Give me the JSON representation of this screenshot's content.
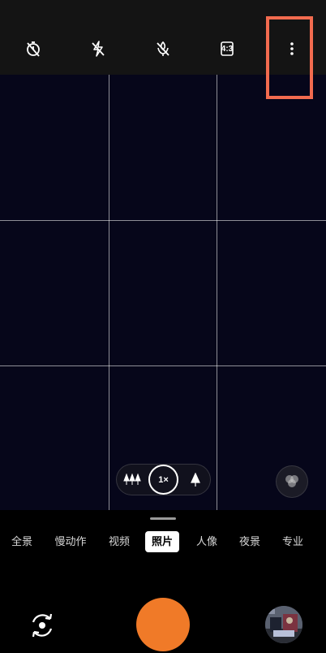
{
  "top_toolbar": {
    "buttons": [
      {
        "name": "timer-off-icon"
      },
      {
        "name": "flash-off-icon"
      },
      {
        "name": "macro-off-icon"
      },
      {
        "name": "aspect-ratio-icon",
        "label": "4:3"
      },
      {
        "name": "more-options-icon"
      }
    ]
  },
  "zoom": {
    "wide_icon": "wide-angle-trees-icon",
    "current": "1×",
    "tele_icon": "telephoto-tree-icon"
  },
  "filter_icon": "filter-circles-icon",
  "modes": [
    "全景",
    "慢动作",
    "视频",
    "照片",
    "人像",
    "夜景",
    "专业"
  ],
  "active_mode": "照片",
  "controls": {
    "switch_camera_icon": "switch-camera-icon",
    "shutter": "shutter-button",
    "gallery": "gallery-thumbnail"
  },
  "colors": {
    "accent": "#f07a28",
    "highlight": "#f26b4f",
    "viewfinder": "#06061a"
  }
}
